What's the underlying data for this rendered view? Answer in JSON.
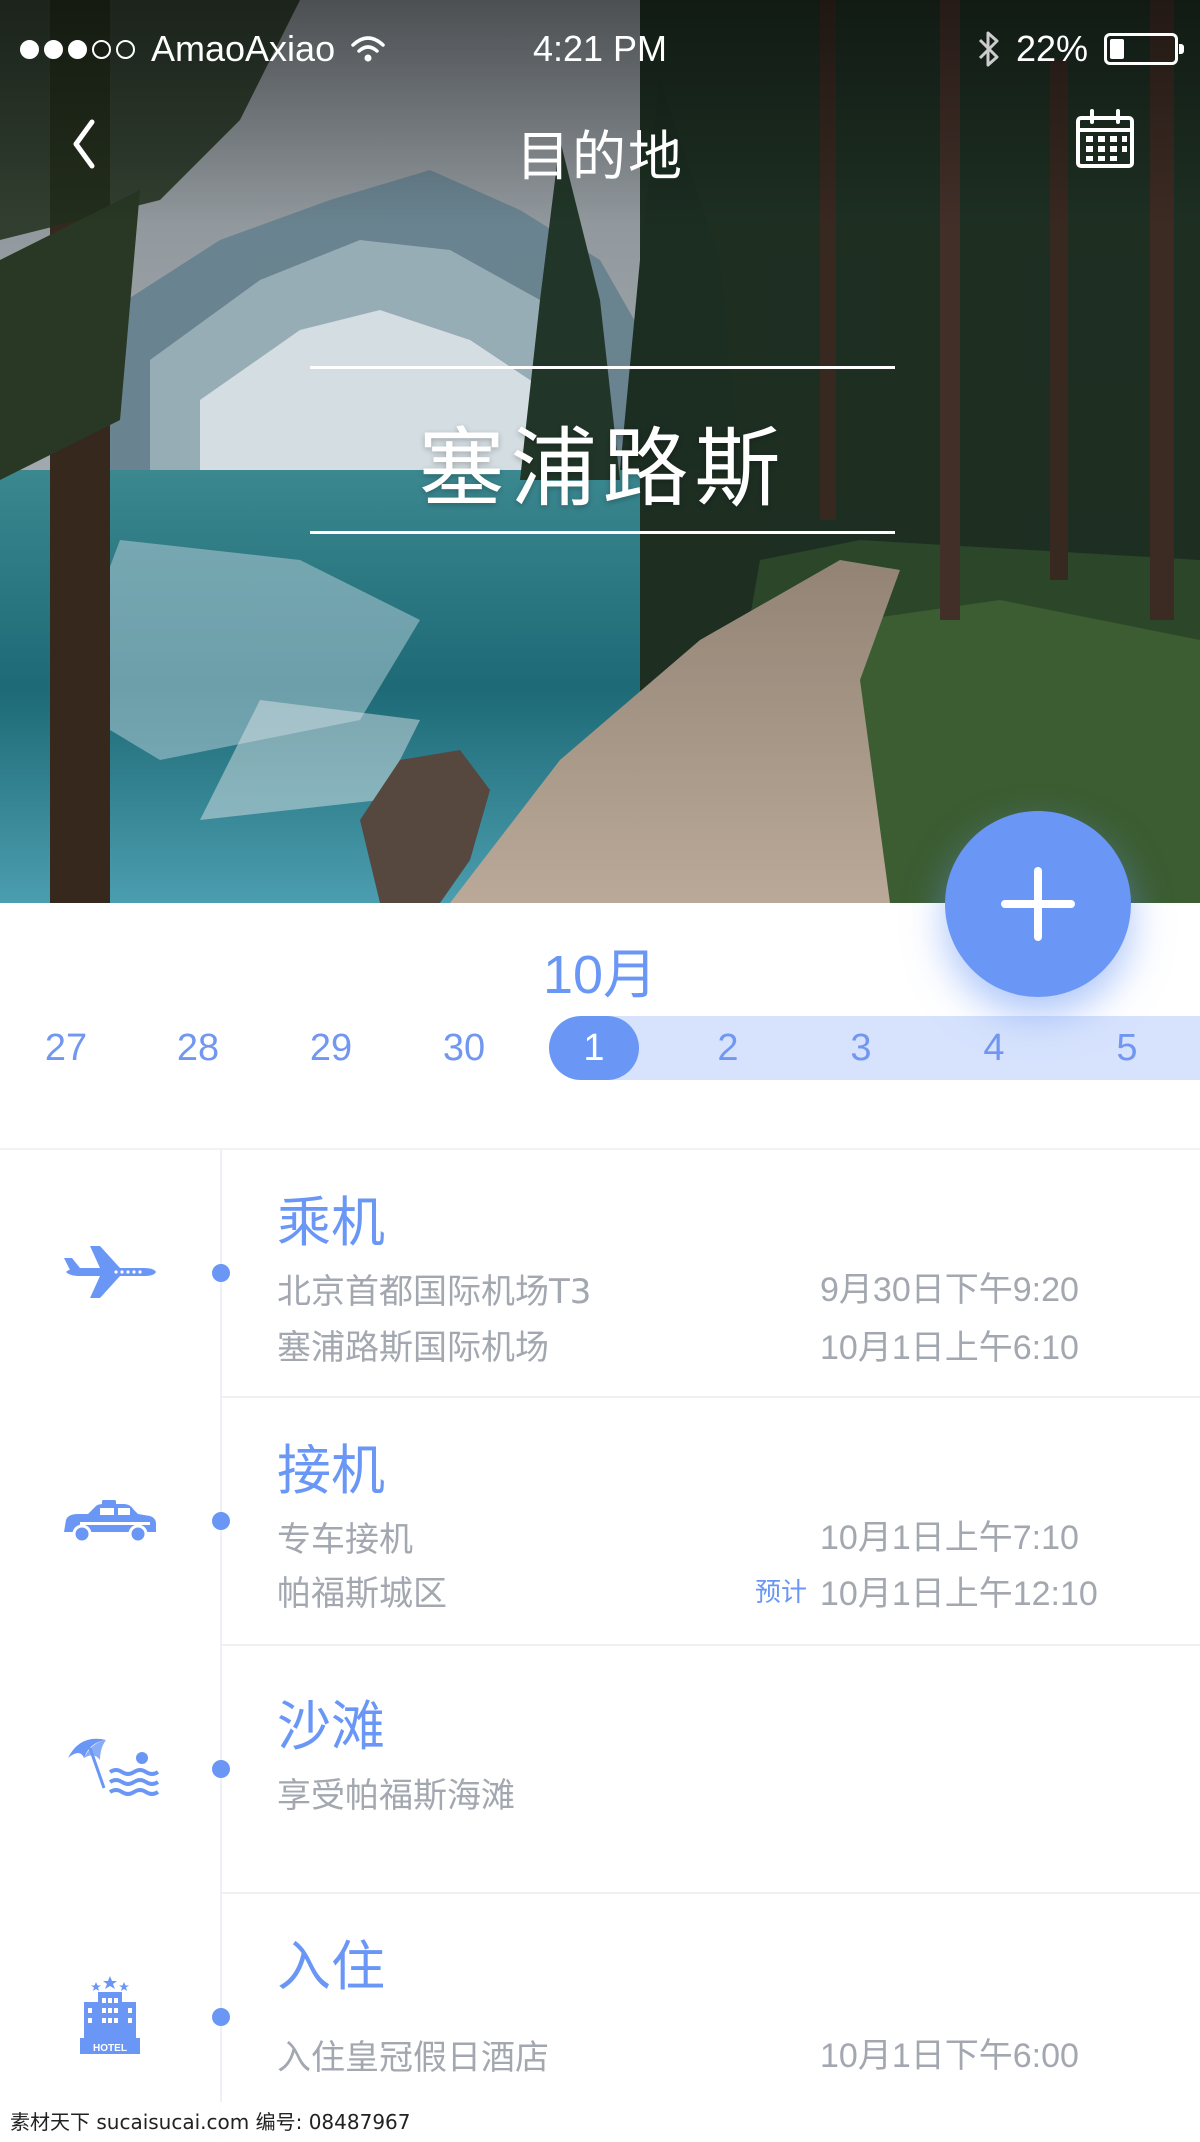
{
  "status_bar": {
    "carrier": "AmaoAxiao",
    "time": "4:21 PM",
    "battery": "22%",
    "battery_level": 0.22
  },
  "nav": {
    "title": "目的地"
  },
  "destination": {
    "name": "塞浦路斯"
  },
  "calendar": {
    "month": "10月",
    "dates": [
      "27",
      "28",
      "29",
      "30",
      "1",
      "2",
      "3",
      "4",
      "5"
    ],
    "selected": "1"
  },
  "events": [
    {
      "title": "乘机",
      "icon": "airplane-icon",
      "lines": [
        {
          "text": "北京首都国际机场T3",
          "time": "9月30日下午9:20"
        },
        {
          "text": "塞浦路斯国际机场",
          "time": "10月1日上午6:10"
        }
      ]
    },
    {
      "title": "接机",
      "icon": "taxi-icon",
      "lines": [
        {
          "text": "专车接机",
          "time": "10月1日上午7:10"
        },
        {
          "text": "帕福斯城区",
          "tag": "预计",
          "time": "10月1日上午12:10"
        }
      ]
    },
    {
      "title": "沙滩",
      "icon": "beach-icon",
      "lines": [
        {
          "text": "享受帕福斯海滩"
        }
      ]
    },
    {
      "title": "入住",
      "icon": "hotel-icon",
      "icon_text": "HOTEL",
      "lines": [
        {
          "text": "入住皇冠假日酒店",
          "time": "10月1日下午6:00"
        }
      ]
    }
  ],
  "watermark": "素材天下 sucaisucai.com  编号: 08487967",
  "colors": {
    "accent": "#6a97f6",
    "range": "#d7e3fd",
    "muted_text": "#a2a7b0"
  }
}
